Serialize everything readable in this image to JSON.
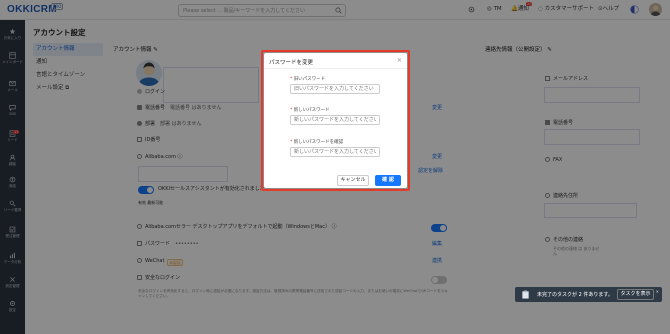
{
  "topbar": {
    "logo": "OKKICRM",
    "logo_badge": "PRO",
    "search_placeholder": "Please select ... 製品/キーワードを入力してください",
    "item_tm": "TM",
    "item_notify": "通知",
    "notify_count": "20",
    "item_support": "カスタマーサポート",
    "item_help": "ヘルプ"
  },
  "sidebar": {
    "items": [
      {
        "label": "お気に入り",
        "icon": "star-icon"
      },
      {
        "label": "メインボード",
        "icon": "dashboard-icon"
      },
      {
        "label": "メール",
        "icon": "mail-icon"
      },
      {
        "label": "SNS",
        "icon": "chat-icon"
      },
      {
        "label": "リード",
        "icon": "lead-icon"
      },
      {
        "label": "顧客",
        "icon": "customer-icon"
      },
      {
        "label": "商談",
        "icon": "deal-icon"
      },
      {
        "label": "リード獲得",
        "icon": "leads-icon"
      },
      {
        "label": "受注管理",
        "icon": "order-icon"
      },
      {
        "label": "データ分析",
        "icon": "chart-icon"
      },
      {
        "label": "設定管理",
        "icon": "settings-icon"
      },
      {
        "label": "設定",
        "icon": "gear-icon"
      }
    ],
    "badge": "13"
  },
  "page": {
    "title": "アカウント設定",
    "subnav": [
      "アカウント情報",
      "通知",
      "言語とタイムゾーン",
      "メール設定"
    ]
  },
  "account": {
    "section_title": "アカウント情報",
    "login_label": "ログイン",
    "phone_label": "電話番号",
    "phone_value": "電話番号 はありません",
    "dept_label": "部署",
    "dept_value": "部署 はありません",
    "id_label": "ID番号",
    "alibaba_label": "Alibaba.com",
    "change_link": "変更",
    "ai_assistant": "OKKIセールスアシスタントが有効化されました",
    "cancel_link": "認定を解除",
    "version": "有効 最新可能",
    "desktop_app": "Alibaba.comセラー デスクトップアプリをデフォルトで起動（WindowsとMac）",
    "password_label": "パスワード",
    "password_value": "••••••••",
    "edit_link": "編集",
    "wechat_label": "WeChat",
    "wechat_tag": "未認証",
    "wechat_link": "連携",
    "secure_login_label": "安全なログイン",
    "secure_login_desc": "安全なログインを有効化すると、ログイン時に認証が必要になります。認証方法は、登録済みの携帯電話番号に送信された認証コードの入力、またはお使いの端末にWeChatでQRコードをスキャンしてください。"
  },
  "contact": {
    "section_title": "連絡先情報（公開設定）",
    "email_label": "メールアドレス",
    "phone_label": "電話番号",
    "fax_label": "FAX",
    "address_label": "連絡先住所",
    "other_label": "その他の連絡",
    "other_value": "その他の連絡 は ありません"
  },
  "modal": {
    "title": "パスワードを変更",
    "old_label": "旧いパスワード",
    "old_placeholder": "旧いパスワードを入力してください",
    "new_label": "新しいパスワード",
    "new_placeholder": "新しいパスワードを入力してください",
    "confirm_label": "新しいパスワードを確認",
    "confirm_placeholder": "新しいパスワードを入力してください",
    "cancel": "キャンセル",
    "ok": "確 認"
  },
  "toast": {
    "text": "未完了のタスクが 2 件あります。",
    "button": "タスクを表示"
  },
  "colors": {
    "accent": "#1677ff",
    "highlight_border": "#e53a2a",
    "sidebar_bg": "#2b3540"
  }
}
